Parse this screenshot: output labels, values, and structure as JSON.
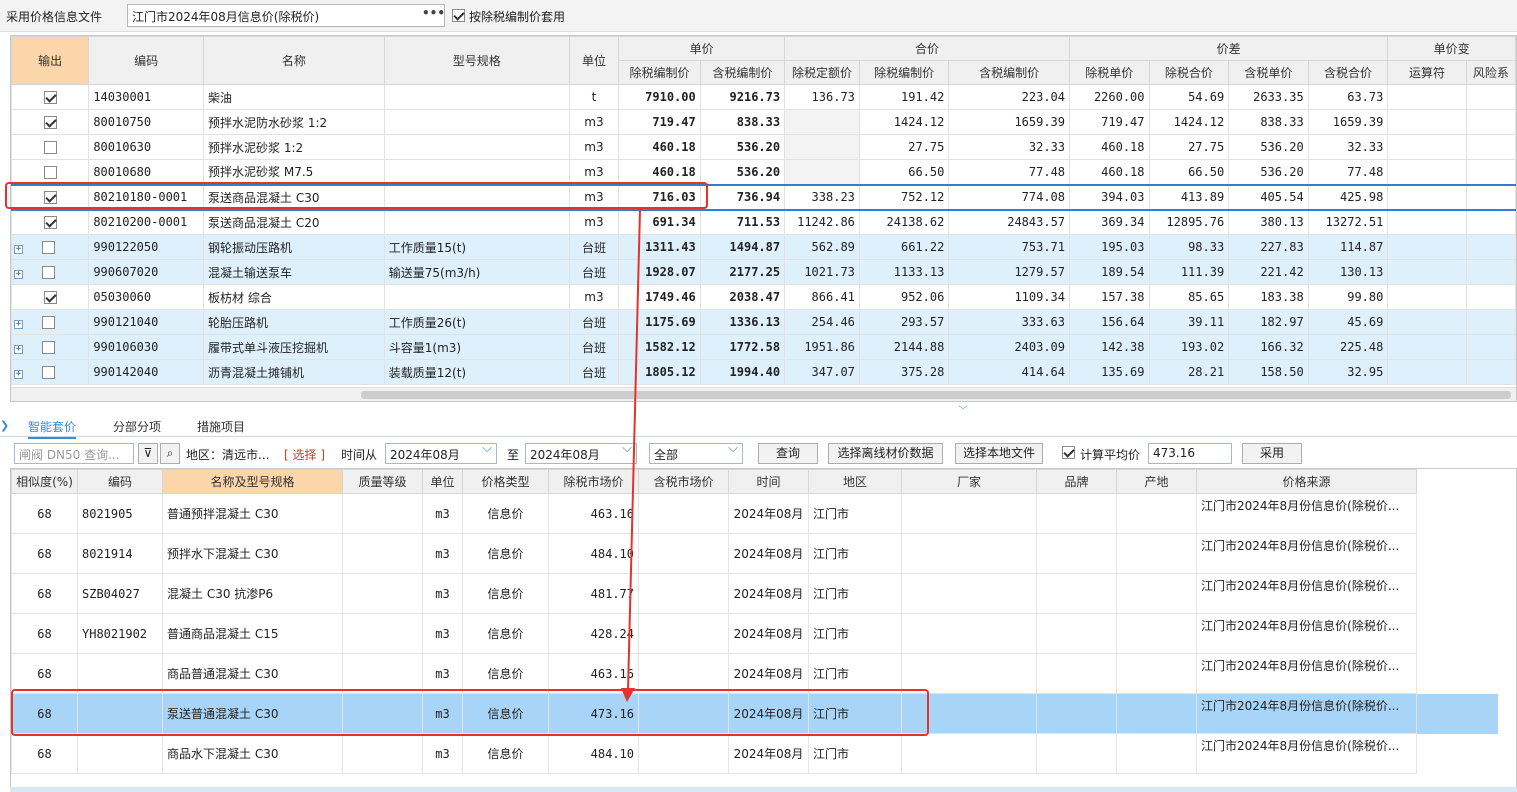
{
  "top": {
    "label": "采用价格信息文件",
    "file_value": "江门市2024年08月信息价(除税价)",
    "dots": "•••",
    "tax_checkbox_label": "按除税编制价套用"
  },
  "upper_table": {
    "headers": {
      "output": "输出",
      "code": "编码",
      "name": "名称",
      "spec": "型号规格",
      "unit": "单位",
      "unit_price": "单价",
      "total_price": "合价",
      "diff": "价差",
      "unit_change": "单价变",
      "excl_tax_price": "除税编制价",
      "incl_tax_price": "含税编制价",
      "excl_tax_quota": "除税定额价",
      "excl_tax_total": "除税编制价",
      "incl_tax_total": "含税编制价",
      "diff_excl_unit": "除税单价",
      "diff_excl_total": "除税合价",
      "diff_incl_unit": "含税单价",
      "diff_incl_total": "含税合价",
      "operator": "运算符",
      "risk": "风险系"
    },
    "rows": [
      {
        "code": "14030001",
        "name": "柴油",
        "spec": "",
        "unit": "t",
        "p1": "7910.00",
        "p2": "9216.73",
        "t1": "136.73",
        "t2": "191.42",
        "t3": "223.04",
        "d1": "2260.00",
        "d2": "54.69",
        "d3": "2633.35",
        "d4": "63.73"
      },
      {
        "code": "80010750",
        "name": "预拌水泥防水砂浆 1:2",
        "spec": "",
        "unit": "m3",
        "p1": "719.47",
        "p2": "838.33",
        "t1": "",
        "t2": "1424.12",
        "t3": "1659.39",
        "d1": "719.47",
        "d2": "1424.12",
        "d3": "838.33",
        "d4": "1659.39"
      },
      {
        "code": "80010630",
        "name": "预拌水泥砂浆 1:2",
        "spec": "",
        "unit": "m3",
        "p1": "460.18",
        "p2": "536.20",
        "t1": "",
        "t2": "27.75",
        "t3": "32.33",
        "d1": "460.18",
        "d2": "27.75",
        "d3": "536.20",
        "d4": "32.33"
      },
      {
        "code": "80010680",
        "name": "预拌水泥砂浆 M7.5",
        "spec": "",
        "unit": "m3",
        "p1": "460.18",
        "p2": "536.20",
        "t1": "",
        "t2": "66.50",
        "t3": "77.48",
        "d1": "460.18",
        "d2": "66.50",
        "d3": "536.20",
        "d4": "77.48"
      },
      {
        "code": "80210180-0001",
        "name": "泵送商品混凝土 C30",
        "spec": "",
        "unit": "m3",
        "p1": "716.03",
        "p2": "736.94",
        "t1": "338.23",
        "t2": "752.12",
        "t3": "774.08",
        "d1": "394.03",
        "d2": "413.89",
        "d3": "405.54",
        "d4": "425.98"
      },
      {
        "code": "80210200-0001",
        "name": "泵送商品混凝土 C20",
        "spec": "",
        "unit": "m3",
        "p1": "691.34",
        "p2": "711.53",
        "t1": "11242.86",
        "t2": "24138.62",
        "t3": "24843.57",
        "d1": "369.34",
        "d2": "12895.76",
        "d3": "380.13",
        "d4": "13272.51"
      },
      {
        "code": "990122050",
        "name": "钢轮振动压路机",
        "spec": "工作质量15(t)",
        "unit": "台班",
        "p1": "1311.43",
        "p2": "1494.87",
        "t1": "562.89",
        "t2": "661.22",
        "t3": "753.71",
        "d1": "195.03",
        "d2": "98.33",
        "d3": "227.83",
        "d4": "114.87"
      },
      {
        "code": "990607020",
        "name": "混凝土输送泵车",
        "spec": "输送量75(m3/h)",
        "unit": "台班",
        "p1": "1928.07",
        "p2": "2177.25",
        "t1": "1021.73",
        "t2": "1133.13",
        "t3": "1279.57",
        "d1": "189.54",
        "d2": "111.39",
        "d3": "221.42",
        "d4": "130.13"
      },
      {
        "code": "05030060",
        "name": "板枋材 综合",
        "spec": "",
        "unit": "m3",
        "p1": "1749.46",
        "p2": "2038.47",
        "t1": "866.41",
        "t2": "952.06",
        "t3": "1109.34",
        "d1": "157.38",
        "d2": "85.65",
        "d3": "183.38",
        "d4": "99.80"
      },
      {
        "code": "990121040",
        "name": "轮胎压路机",
        "spec": "工作质量26(t)",
        "unit": "台班",
        "p1": "1175.69",
        "p2": "1336.13",
        "t1": "254.46",
        "t2": "293.57",
        "t3": "333.63",
        "d1": "156.64",
        "d2": "39.11",
        "d3": "182.97",
        "d4": "45.69"
      },
      {
        "code": "990106030",
        "name": "履带式单斗液压挖掘机",
        "spec": "斗容量1(m3)",
        "unit": "台班",
        "p1": "1582.12",
        "p2": "1772.58",
        "t1": "1951.86",
        "t2": "2144.88",
        "t3": "2403.09",
        "d1": "142.38",
        "d2": "193.02",
        "d3": "166.32",
        "d4": "225.48"
      },
      {
        "code": "990142040",
        "name": "沥青混凝土摊铺机",
        "spec": "装载质量12(t)",
        "unit": "台班",
        "p1": "1805.12",
        "p2": "1994.40",
        "t1": "347.07",
        "t2": "375.28",
        "t3": "414.64",
        "d1": "135.69",
        "d2": "28.21",
        "d3": "158.50",
        "d4": "32.95"
      }
    ]
  },
  "tabs": [
    "智能套价",
    "分部分项",
    "措施项目"
  ],
  "filter": {
    "search_placeholder": "闸阀 DN50 查询...",
    "region_label": "地区：清远市...",
    "select_link": "选择",
    "time_from_label": "时间从",
    "time_from": "2024年08月",
    "to_label": "至",
    "time_to": "2024年08月",
    "type_value": "全部",
    "query_btn": "查询",
    "offline_btn": "选择离线材价数据",
    "local_btn": "选择本地文件",
    "avg_label": "计算平均价",
    "avg_value": "473.16",
    "apply_btn": "采用"
  },
  "lower_table": {
    "headers": [
      "相似度(%)",
      "编码",
      "名称及型号规格",
      "质量等级",
      "单位",
      "价格类型",
      "除税市场价",
      "含税市场价",
      "时间",
      "地区",
      "厂家",
      "品牌",
      "产地",
      "价格来源"
    ],
    "rows": [
      {
        "sim": "68",
        "code": "8021905",
        "name": "普通预拌混凝土 C30",
        "unit": "m3",
        "type": "信息价",
        "price": "463.16",
        "time": "2024年08月",
        "region": "江门市",
        "source": "江门市2024年8月份信息价(除税价..."
      },
      {
        "sim": "68",
        "code": "8021914",
        "name": "预拌水下混凝土 C30",
        "unit": "m3",
        "type": "信息价",
        "price": "484.10",
        "time": "2024年08月",
        "region": "江门市",
        "source": "江门市2024年8月份信息价(除税价..."
      },
      {
        "sim": "68",
        "code": "SZB04027",
        "name": "混凝土 C30 抗渗P6",
        "unit": "m3",
        "type": "信息价",
        "price": "481.77",
        "time": "2024年08月",
        "region": "江门市",
        "source": "江门市2024年8月份信息价(除税价..."
      },
      {
        "sim": "68",
        "code": "YH8021902",
        "name": "普通商品混凝土 C15",
        "unit": "m3",
        "type": "信息价",
        "price": "428.24",
        "time": "2024年08月",
        "region": "江门市",
        "source": "江门市2024年8月份信息价(除税价..."
      },
      {
        "sim": "68",
        "code": "",
        "name": "商品普通混凝土 C30",
        "unit": "m3",
        "type": "信息价",
        "price": "463.16",
        "time": "2024年08月",
        "region": "江门市",
        "source": "江门市2024年8月份信息价(除税价..."
      },
      {
        "sim": "68",
        "code": "",
        "name": "泵送普通混凝土 C30",
        "unit": "m3",
        "type": "信息价",
        "price": "473.16",
        "time": "2024年08月",
        "region": "江门市",
        "source": "江门市2024年8月份信息价(除税价..."
      },
      {
        "sim": "68",
        "code": "",
        "name": "商品水下混凝土 C30",
        "unit": "m3",
        "type": "信息价",
        "price": "484.10",
        "time": "2024年08月",
        "region": "江门市",
        "source": "江门市2024年8月份信息价(除税价..."
      }
    ]
  },
  "colors": {
    "accent": "#3b8bd4",
    "highlight_row": "#a8d4f8",
    "machine_row": "#dff0fd",
    "output_header": "#fbd6aa",
    "annotation_red": "#e5322d"
  }
}
